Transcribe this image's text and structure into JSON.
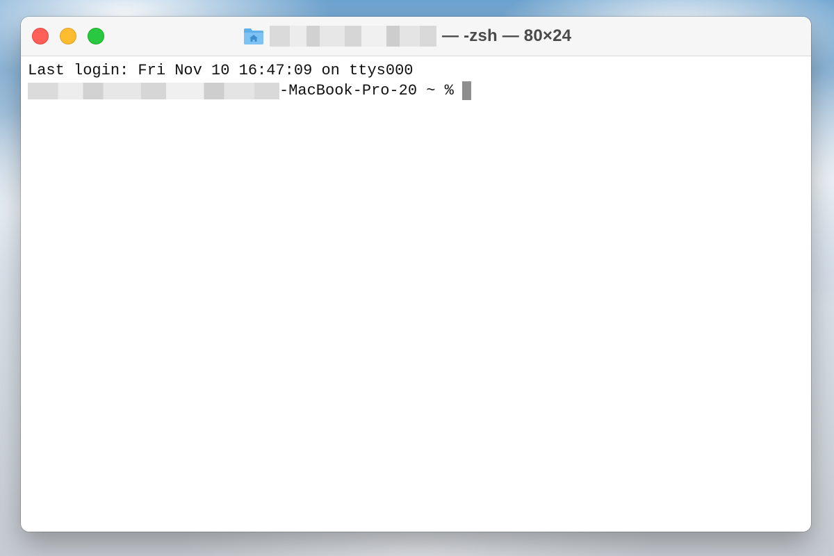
{
  "window": {
    "title_suffix": "— -zsh — 80×24",
    "title_redacted": true,
    "folder_icon": "home-folder-icon"
  },
  "traffic_lights": {
    "close_color": "#fe5f57",
    "minimize_color": "#febc2e",
    "zoom_color": "#28c840"
  },
  "terminal": {
    "last_login": "Last login: Fri Nov 10 16:47:09 on ttys000",
    "prompt_host_suffix": "-MacBook-Pro-20",
    "prompt_rest": " ~ %",
    "cursor_color": "#8e8e8e"
  }
}
